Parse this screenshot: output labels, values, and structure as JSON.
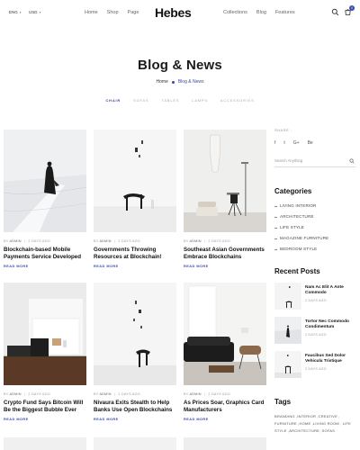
{
  "header": {
    "language": "ENG",
    "currency": "USD",
    "nav_left": [
      "Home",
      "Shop",
      "Page"
    ],
    "logo": "Hebes",
    "nav_right": [
      "Collections",
      "Blog",
      "Features"
    ],
    "cart_count": "0"
  },
  "page": {
    "title": "Blog & News",
    "breadcrumb": [
      "Home",
      "Blog & News"
    ]
  },
  "filters": [
    "CHAIR",
    "SOFAS",
    "TABLES",
    "LAMPS",
    "ACCESSORIES"
  ],
  "posts": [
    {
      "author_prefix": "BY",
      "author": "ADMIN",
      "date": "2 DAYS AGO",
      "title": "Blockchain-based Mobile Payments Service Developed",
      "read_more": "READ MORE"
    },
    {
      "author_prefix": "BY",
      "author": "ADMIN",
      "date": "2 DAYS AGO",
      "title": "Governments Throwing Resources at Blockchain!",
      "read_more": "READ MORE"
    },
    {
      "author_prefix": "BY",
      "author": "ADMIN",
      "date": "2 DAYS AGO",
      "title": "Southeast Asian Governments Embrace Blockchains",
      "read_more": "READ MORE"
    },
    {
      "author_prefix": "BY",
      "author": "ADMIN",
      "date": "2 DAYS AGO",
      "title": "Crypto Fund Says Bitcoin Will Be the Biggest Bubble Ever",
      "read_more": "READ MORE"
    },
    {
      "author_prefix": "BY",
      "author": "ADMIN",
      "date": "2 DAYS AGO",
      "title": "Nivaura Exits Stealth to Help Banks Use Open Blockchains",
      "read_more": "READ MORE"
    },
    {
      "author_prefix": "BY",
      "author": "ADMIN",
      "date": "2 DAYS AGO",
      "title": "As Prices Soar, Graphics Card Manufacturers",
      "read_more": "READ MORE"
    }
  ],
  "sidebar": {
    "share_label": "SHARE :",
    "share_icons": [
      "f",
      "t",
      "G+",
      "Be"
    ],
    "search_placeholder": "Search Anything",
    "categories_title": "Categories",
    "categories": [
      "LIVING INTERIOR",
      "ARCHITECTURE",
      "LIFE STYLE",
      "MAGAZINE FURNITURE",
      "BEDROOM STYLE"
    ],
    "recent_title": "Recent Posts",
    "recent_posts": [
      {
        "title": "Nam Ac Elit A Ante Commodo",
        "date": "2 DAYS AGO"
      },
      {
        "title": "Tortor Nec Commodo Condimentum",
        "date": "2 DAYS AGO"
      },
      {
        "title": "Faucibus Sed Dolor Vehicula Tristique",
        "date": "2 DAYS AGO"
      }
    ],
    "tags_title": "Tags",
    "tags": "BRANDING ,INTERIOR ,CREATIVE , FURNITURE ,HOME ,LIVING ROOM , LIFE STYLE ,ARCHITECTURE ,SOFAS"
  },
  "colors": {
    "accent": "#3b4aa3",
    "text": "#111111",
    "muted": "#999999"
  }
}
